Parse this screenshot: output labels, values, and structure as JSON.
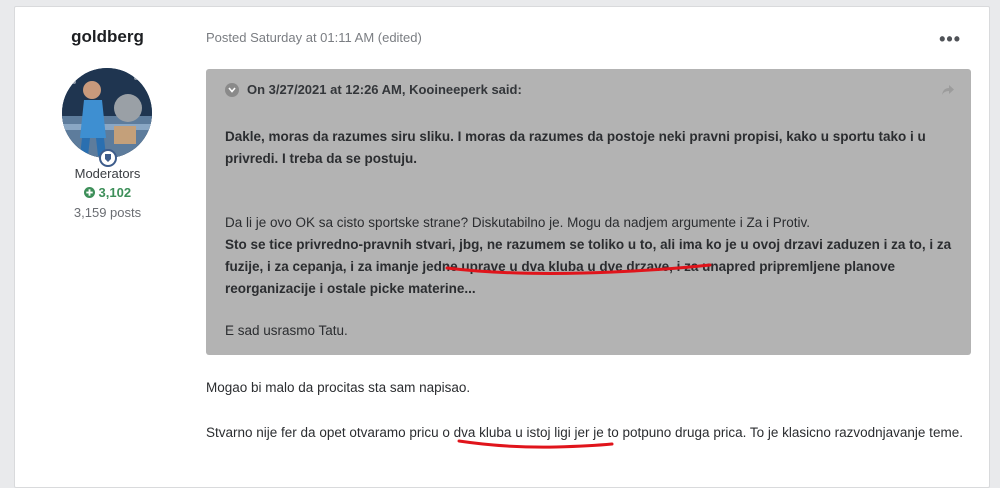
{
  "author": {
    "name": "goldberg",
    "group": "Moderators",
    "reputation": "3,102",
    "posts": "3,159 posts"
  },
  "post": {
    "meta": "Posted Saturday at 01:11 AM (edited)",
    "menu": "•••"
  },
  "quote": {
    "header": "On 3/27/2021 at 12:26 AM, Kooineeperk said:",
    "para1": "Dakle, moras da razumes siru sliku. I moras da razumes da postoje neki pravni propisi, kako u sportu tako i u privredi. I treba da se postuju.",
    "para2": "Da li je ovo OK sa cisto sportske strane? Diskutabilno je. Mogu da nadjem argumente i Za i Protiv.",
    "para3_a": "Sto se tice privredno-pravnih stvari, jbg, ne razumem se toliko u to, ali ima ko je u ovoj drzavi zaduzen i za to, i za fuzije, i za cepanja, i za imanje ",
    "para3_b": "jedne uprave u dva kluba u dve drzave",
    "para3_c": ", i za unapred pripremljene planove reorganizacije i ostale picke materine...",
    "para4": "E sad usrasmo Tatu."
  },
  "reply": {
    "para1": "Mogao bi malo da procitas sta sam napisao.",
    "para2_a": "Stvarno nije fer da opet otvaramo pricu ",
    "para2_b": "o dva kluba u istoj ligi",
    "para2_c": " jer je to potpuno druga prica. To je klasicno razvodnjavanje teme."
  },
  "colors": {
    "quote_bg": "#b3b3b3",
    "reputation": "#3d8f59",
    "annotation": "#e0141b"
  },
  "icons": [
    "chevron-down-icon",
    "share-icon",
    "plus-circle-icon",
    "moderator-badge-icon"
  ]
}
